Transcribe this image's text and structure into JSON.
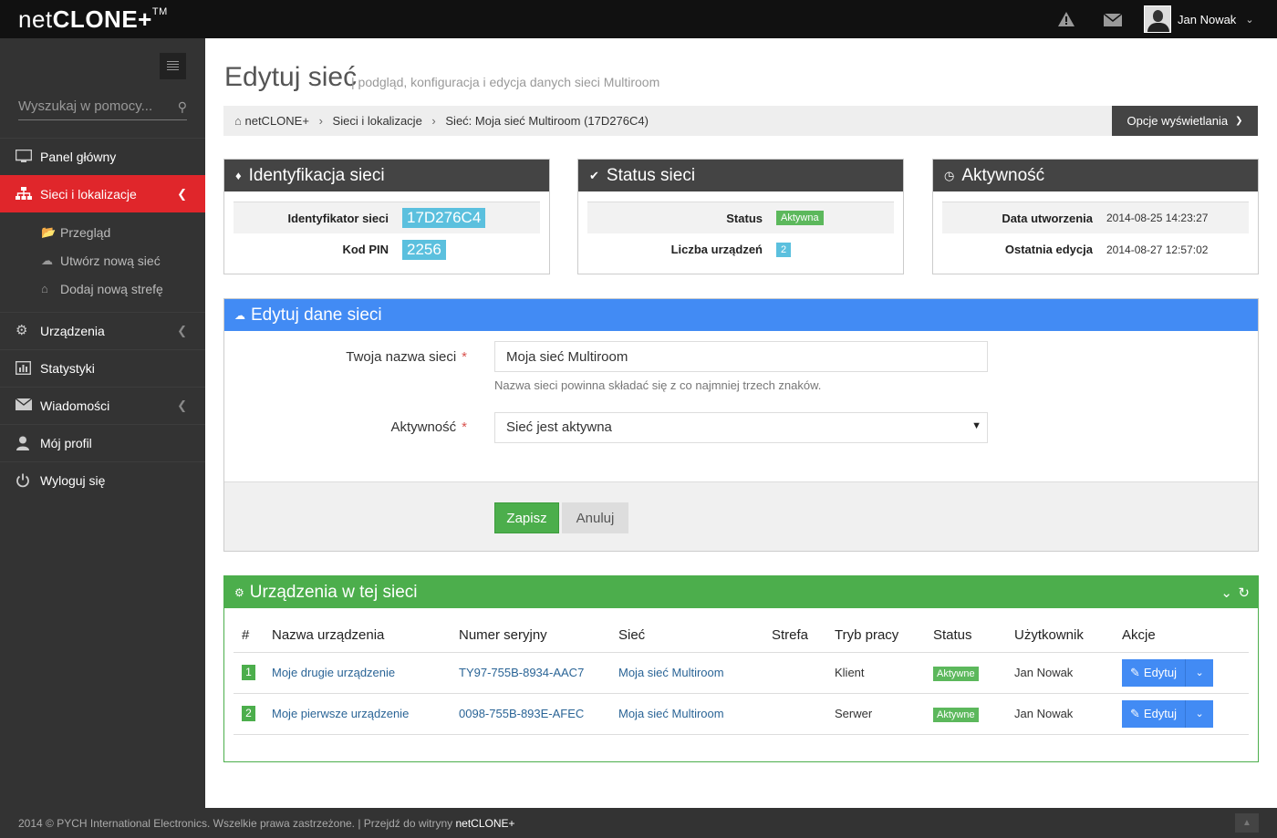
{
  "app": {
    "logo_thin": "net",
    "logo_bold": "CLONE+",
    "logo_tm": "TM"
  },
  "topbar": {
    "user_name": "Jan Nowak",
    "icons": [
      "warning-icon",
      "envelope-icon",
      "chevron-down-icon"
    ]
  },
  "sidebar": {
    "search_placeholder": "Wyszukaj w pomocy...",
    "items": [
      {
        "label": "Panel główny",
        "icon": "monitor-icon"
      },
      {
        "label": "Sieci i lokalizacje",
        "icon": "sitemap-icon",
        "active": true
      },
      {
        "label": "Urządzenia",
        "icon": "cogs-icon"
      },
      {
        "label": "Statystyki",
        "icon": "bar-chart-icon"
      },
      {
        "label": "Wiadomości",
        "icon": "envelope-icon"
      },
      {
        "label": "Mój profil",
        "icon": "user-icon"
      },
      {
        "label": "Wyloguj się",
        "icon": "power-icon"
      }
    ],
    "subitems": [
      {
        "label": "Przegląd",
        "icon": "folder-open-icon"
      },
      {
        "label": "Utwórz nową sieć",
        "icon": "cloud-icon"
      },
      {
        "label": "Dodaj nową strefę",
        "icon": "home-icon"
      }
    ]
  },
  "page": {
    "title": "Edytuj sieć",
    "subtitle": "| podgląd, konfiguracja i edycja danych sieci Multiroom",
    "breadcrumb": [
      "netCLONE+",
      "Sieci i lokalizacje",
      "Sieć: Moja sieć Multiroom (17D276C4)"
    ],
    "options_button": "Opcje wyświetlania"
  },
  "identification": {
    "title": "Identyfikacja sieci",
    "id_label": "Identyfikator sieci",
    "id_value": "17D276C4",
    "pin_label": "Kod PIN",
    "pin_value": "2256"
  },
  "status": {
    "title": "Status sieci",
    "status_label": "Status",
    "status_value": "Aktywna",
    "devices_label": "Liczba urządzeń",
    "devices_value": "2"
  },
  "activity": {
    "title": "Aktywność",
    "created_label": "Data utworzenia",
    "created_value": "2014-08-25 14:23:27",
    "edited_label": "Ostatnia edycja",
    "edited_value": "2014-08-27 12:57:02"
  },
  "edit_form": {
    "title": "Edytuj dane sieci",
    "name_label": "Twoja nazwa sieci",
    "name_value": "Moja sieć Multiroom",
    "name_help": "Nazwa sieci powinna składać się z co najmniej trzech znaków.",
    "activity_label": "Aktywność",
    "activity_value": "Sieć jest aktywna",
    "required_mark": "*",
    "save": "Zapisz",
    "cancel": "Anuluj"
  },
  "devices": {
    "title": "Urządzenia w tej sieci",
    "columns": [
      "#",
      "Nazwa urządzenia",
      "Numer seryjny",
      "Sieć",
      "Strefa",
      "Tryb pracy",
      "Status",
      "Użytkownik",
      "Akcje"
    ],
    "rows": [
      {
        "num": "1",
        "name": "Moje drugie urządzenie",
        "serial": "TY97-755B-8934-AAC7",
        "network": "Moja sieć Multiroom",
        "zone": "",
        "mode": "Klient",
        "status": "Aktywne",
        "user": "Jan Nowak",
        "action": "Edytuj"
      },
      {
        "num": "2",
        "name": "Moje pierwsze urządzenie",
        "serial": "0098-755B-893E-AFEC",
        "network": "Moja sieć Multiroom",
        "zone": "",
        "mode": "Serwer",
        "status": "Aktywne",
        "user": "Jan Nowak",
        "action": "Edytuj"
      }
    ]
  },
  "footer": {
    "text": "2014 © PYCH International Electronics. Wszelkie prawa zastrzeżone. | Przejdź do witryny",
    "link": "netCLONE+"
  },
  "colors": {
    "accent_red": "#e0262b",
    "blue": "#428bf4",
    "green": "#4cae4c",
    "info": "#5bc0de"
  }
}
